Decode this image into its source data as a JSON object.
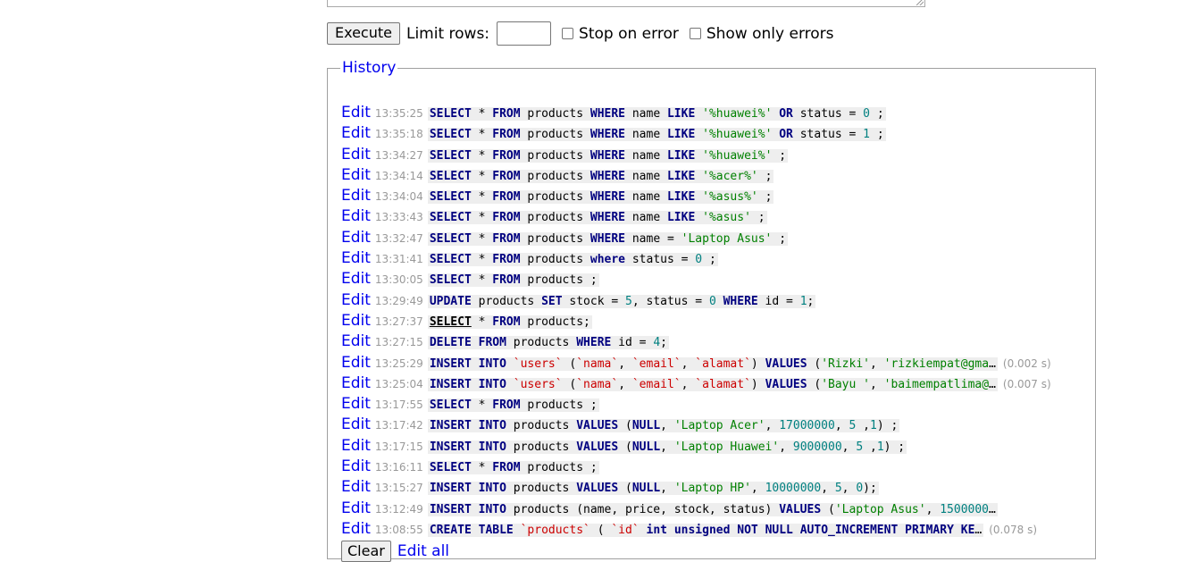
{
  "toolbar": {
    "execute_label": "Execute",
    "limit_rows_label": "Limit rows:",
    "limit_rows_value": "",
    "stop_on_error_label": "Stop on error",
    "show_only_errors_label": "Show only errors"
  },
  "history": {
    "legend": "History",
    "edit_label": "Edit",
    "clear_label": "Clear",
    "edit_all_label": "Edit all",
    "entries": [
      {
        "time": "13:35:25",
        "duration": "",
        "tokens": [
          [
            "kw",
            "SELECT"
          ],
          [
            "t",
            " * "
          ],
          [
            "kw",
            "FROM"
          ],
          [
            "t",
            " products "
          ],
          [
            "kw",
            "WHERE"
          ],
          [
            "t",
            " name "
          ],
          [
            "kw",
            "LIKE"
          ],
          [
            "t",
            " "
          ],
          [
            "str",
            "'%huawei%'"
          ],
          [
            "t",
            " "
          ],
          [
            "kw",
            "OR"
          ],
          [
            "t",
            " status = "
          ],
          [
            "num",
            "0"
          ],
          [
            "t",
            "  ;"
          ]
        ]
      },
      {
        "time": "13:35:18",
        "duration": "",
        "tokens": [
          [
            "kw",
            "SELECT"
          ],
          [
            "t",
            " * "
          ],
          [
            "kw",
            "FROM"
          ],
          [
            "t",
            " products "
          ],
          [
            "kw",
            "WHERE"
          ],
          [
            "t",
            " name "
          ],
          [
            "kw",
            "LIKE"
          ],
          [
            "t",
            " "
          ],
          [
            "str",
            "'%huawei%'"
          ],
          [
            "t",
            " "
          ],
          [
            "kw",
            "OR"
          ],
          [
            "t",
            " status = "
          ],
          [
            "num",
            "1"
          ],
          [
            "t",
            "  ;"
          ]
        ]
      },
      {
        "time": "13:34:27",
        "duration": "",
        "tokens": [
          [
            "kw",
            "SELECT"
          ],
          [
            "t",
            " * "
          ],
          [
            "kw",
            "FROM"
          ],
          [
            "t",
            " products "
          ],
          [
            "kw",
            "WHERE"
          ],
          [
            "t",
            " name "
          ],
          [
            "kw",
            "LIKE"
          ],
          [
            "t",
            " "
          ],
          [
            "str",
            "'%huawei%'"
          ],
          [
            "t",
            "  ;"
          ]
        ]
      },
      {
        "time": "13:34:14",
        "duration": "",
        "tokens": [
          [
            "kw",
            "SELECT"
          ],
          [
            "t",
            " * "
          ],
          [
            "kw",
            "FROM"
          ],
          [
            "t",
            " products "
          ],
          [
            "kw",
            "WHERE"
          ],
          [
            "t",
            " name "
          ],
          [
            "kw",
            "LIKE"
          ],
          [
            "t",
            " "
          ],
          [
            "str",
            "'%acer%'"
          ],
          [
            "t",
            "  ;"
          ]
        ]
      },
      {
        "time": "13:34:04",
        "duration": "",
        "tokens": [
          [
            "kw",
            "SELECT"
          ],
          [
            "t",
            " * "
          ],
          [
            "kw",
            "FROM"
          ],
          [
            "t",
            " products "
          ],
          [
            "kw",
            "WHERE"
          ],
          [
            "t",
            " name "
          ],
          [
            "kw",
            "LIKE"
          ],
          [
            "t",
            " "
          ],
          [
            "str",
            "'%asus%'"
          ],
          [
            "t",
            "  ;"
          ]
        ]
      },
      {
        "time": "13:33:43",
        "duration": "",
        "tokens": [
          [
            "kw",
            "SELECT"
          ],
          [
            "t",
            " * "
          ],
          [
            "kw",
            "FROM"
          ],
          [
            "t",
            " products "
          ],
          [
            "kw",
            "WHERE"
          ],
          [
            "t",
            " name "
          ],
          [
            "kw",
            "LIKE"
          ],
          [
            "t",
            " "
          ],
          [
            "str",
            "'%asus'"
          ],
          [
            "t",
            "  ;"
          ]
        ]
      },
      {
        "time": "13:32:47",
        "duration": "",
        "tokens": [
          [
            "kw",
            "SELECT"
          ],
          [
            "t",
            " * "
          ],
          [
            "kw",
            "FROM"
          ],
          [
            "t",
            " products "
          ],
          [
            "kw",
            "WHERE"
          ],
          [
            "t",
            " name = "
          ],
          [
            "str",
            "'Laptop Asus'"
          ],
          [
            "t",
            "  ;"
          ]
        ]
      },
      {
        "time": "13:31:41",
        "duration": "",
        "tokens": [
          [
            "kw",
            "SELECT"
          ],
          [
            "t",
            " * "
          ],
          [
            "kw",
            "FROM"
          ],
          [
            "t",
            " products "
          ],
          [
            "kw",
            "where"
          ],
          [
            "t",
            " status = "
          ],
          [
            "num",
            "0"
          ],
          [
            "t",
            "  ;"
          ]
        ]
      },
      {
        "time": "13:30:05",
        "duration": "",
        "tokens": [
          [
            "kw",
            "SELECT"
          ],
          [
            "t",
            " * "
          ],
          [
            "kw",
            "FROM"
          ],
          [
            "t",
            " products  ;"
          ]
        ]
      },
      {
        "time": "13:29:49",
        "duration": "",
        "tokens": [
          [
            "kw",
            "UPDATE"
          ],
          [
            "t",
            " products "
          ],
          [
            "kw",
            "SET"
          ],
          [
            "t",
            " stock = "
          ],
          [
            "num",
            "5"
          ],
          [
            "t",
            ", status = "
          ],
          [
            "num",
            "0"
          ],
          [
            "t",
            " "
          ],
          [
            "kw",
            "WHERE"
          ],
          [
            "t",
            " id = "
          ],
          [
            "num",
            "1"
          ],
          [
            "t",
            ";"
          ]
        ]
      },
      {
        "time": "13:27:37",
        "duration": "",
        "tokens": [
          [
            "kwu",
            "SELECT"
          ],
          [
            "t",
            " * "
          ],
          [
            "kw",
            "FROM"
          ],
          [
            "t",
            " products;"
          ]
        ]
      },
      {
        "time": "13:27:15",
        "duration": "",
        "tokens": [
          [
            "kw",
            "DELETE"
          ],
          [
            "t",
            " "
          ],
          [
            "kw",
            "FROM"
          ],
          [
            "t",
            " products "
          ],
          [
            "kw",
            "WHERE"
          ],
          [
            "t",
            " id = "
          ],
          [
            "num",
            "4"
          ],
          [
            "t",
            ";"
          ]
        ]
      },
      {
        "time": "13:25:29",
        "duration": "(0.002 s)",
        "tokens": [
          [
            "kw",
            "INSERT"
          ],
          [
            "t",
            " "
          ],
          [
            "kw",
            "INTO"
          ],
          [
            "t",
            " "
          ],
          [
            "id",
            "`users`"
          ],
          [
            "t",
            " ("
          ],
          [
            "id",
            "`nama`"
          ],
          [
            "t",
            ", "
          ],
          [
            "id",
            "`email`"
          ],
          [
            "t",
            ", "
          ],
          [
            "id",
            "`alamat`"
          ],
          [
            "t",
            ") "
          ],
          [
            "kw",
            "VALUES"
          ],
          [
            "t",
            " ("
          ],
          [
            "str",
            "'Rizki'"
          ],
          [
            "t",
            ", "
          ],
          [
            "str",
            "'rizkiempat@gma"
          ],
          [
            "t",
            "…"
          ]
        ]
      },
      {
        "time": "13:25:04",
        "duration": "(0.007 s)",
        "tokens": [
          [
            "kw",
            "INSERT"
          ],
          [
            "t",
            " "
          ],
          [
            "kw",
            "INTO"
          ],
          [
            "t",
            " "
          ],
          [
            "id",
            "`users`"
          ],
          [
            "t",
            " ("
          ],
          [
            "id",
            "`nama`"
          ],
          [
            "t",
            ", "
          ],
          [
            "id",
            "`email`"
          ],
          [
            "t",
            ", "
          ],
          [
            "id",
            "`alamat`"
          ],
          [
            "t",
            ") "
          ],
          [
            "kw",
            "VALUES"
          ],
          [
            "t",
            " ("
          ],
          [
            "str",
            "'Bayu '"
          ],
          [
            "t",
            ", "
          ],
          [
            "str",
            "'baimempatlima@"
          ],
          [
            "t",
            "…"
          ]
        ]
      },
      {
        "time": "13:17:55",
        "duration": "",
        "tokens": [
          [
            "kw",
            "SELECT"
          ],
          [
            "t",
            " * "
          ],
          [
            "kw",
            "FROM"
          ],
          [
            "t",
            " products  ;"
          ]
        ]
      },
      {
        "time": "13:17:42",
        "duration": "",
        "tokens": [
          [
            "kw",
            "INSERT"
          ],
          [
            "t",
            " "
          ],
          [
            "kw",
            "INTO"
          ],
          [
            "t",
            " products "
          ],
          [
            "kw",
            "VALUES"
          ],
          [
            "t",
            " ("
          ],
          [
            "kw",
            "NULL"
          ],
          [
            "t",
            ", "
          ],
          [
            "str",
            "'Laptop Acer'"
          ],
          [
            "t",
            ", "
          ],
          [
            "num",
            "17000000"
          ],
          [
            "t",
            ", "
          ],
          [
            "num",
            "5"
          ],
          [
            "t",
            " ,"
          ],
          [
            "num",
            "1"
          ],
          [
            "t",
            ")  ;"
          ]
        ]
      },
      {
        "time": "13:17:15",
        "duration": "",
        "tokens": [
          [
            "kw",
            "INSERT"
          ],
          [
            "t",
            " "
          ],
          [
            "kw",
            "INTO"
          ],
          [
            "t",
            " products "
          ],
          [
            "kw",
            "VALUES"
          ],
          [
            "t",
            " ("
          ],
          [
            "kw",
            "NULL"
          ],
          [
            "t",
            ", "
          ],
          [
            "str",
            "'Laptop Huawei'"
          ],
          [
            "t",
            ", "
          ],
          [
            "num",
            "9000000"
          ],
          [
            "t",
            ", "
          ],
          [
            "num",
            "5"
          ],
          [
            "t",
            " ,"
          ],
          [
            "num",
            "1"
          ],
          [
            "t",
            ")  ;"
          ]
        ]
      },
      {
        "time": "13:16:11",
        "duration": "",
        "tokens": [
          [
            "kw",
            "SELECT"
          ],
          [
            "t",
            " * "
          ],
          [
            "kw",
            "FROM"
          ],
          [
            "t",
            " products  ;"
          ]
        ]
      },
      {
        "time": "13:15:27",
        "duration": "",
        "tokens": [
          [
            "kw",
            "INSERT"
          ],
          [
            "t",
            " "
          ],
          [
            "kw",
            "INTO"
          ],
          [
            "t",
            " products  "
          ],
          [
            "kw",
            "VALUES"
          ],
          [
            "t",
            " ("
          ],
          [
            "kw",
            "NULL"
          ],
          [
            "t",
            ", "
          ],
          [
            "str",
            "'Laptop HP'"
          ],
          [
            "t",
            ", "
          ],
          [
            "num",
            "10000000"
          ],
          [
            "t",
            ", "
          ],
          [
            "num",
            "5"
          ],
          [
            "t",
            ", "
          ],
          [
            "num",
            "0"
          ],
          [
            "t",
            ");"
          ]
        ]
      },
      {
        "time": "13:12:49",
        "duration": "",
        "tokens": [
          [
            "kw",
            "INSERT"
          ],
          [
            "t",
            " "
          ],
          [
            "kw",
            "INTO"
          ],
          [
            "t",
            " products (name, price, stock, status) "
          ],
          [
            "kw",
            "VALUES"
          ],
          [
            "t",
            " ("
          ],
          [
            "str",
            "'Laptop Asus'"
          ],
          [
            "t",
            ", "
          ],
          [
            "num",
            "1500000"
          ],
          [
            "t",
            "…"
          ]
        ]
      },
      {
        "time": "13:08:55",
        "duration": "(0.078 s)",
        "tokens": [
          [
            "kw",
            "CREATE"
          ],
          [
            "t",
            " "
          ],
          [
            "kw",
            "TABLE"
          ],
          [
            "t",
            " "
          ],
          [
            "id",
            "`products`"
          ],
          [
            "t",
            " (   "
          ],
          [
            "id",
            "`id`"
          ],
          [
            "t",
            " "
          ],
          [
            "kw",
            "int"
          ],
          [
            "t",
            " "
          ],
          [
            "kw",
            "unsigned"
          ],
          [
            "t",
            " "
          ],
          [
            "kw",
            "NOT"
          ],
          [
            "t",
            " "
          ],
          [
            "kw",
            "NULL"
          ],
          [
            "t",
            " "
          ],
          [
            "kw",
            "AUTO_INCREMENT"
          ],
          [
            "t",
            " "
          ],
          [
            "kw",
            "PRIMARY"
          ],
          [
            "t",
            " "
          ],
          [
            "kw",
            "KE"
          ],
          [
            "t",
            "…"
          ]
        ]
      }
    ]
  }
}
